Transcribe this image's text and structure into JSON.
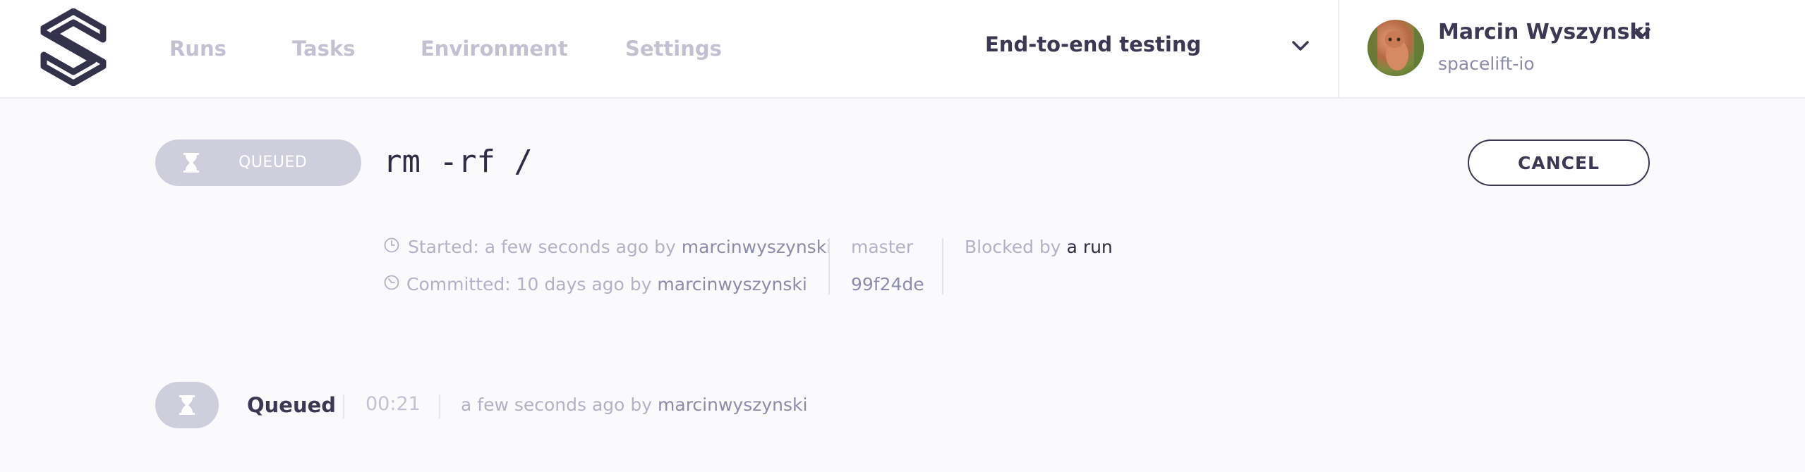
{
  "nav": {
    "items": [
      "Runs",
      "Tasks",
      "Environment",
      "Settings"
    ]
  },
  "stack": {
    "name": "End-to-end testing"
  },
  "user": {
    "name": "Marcin Wyszynski",
    "org": "spacelift-io"
  },
  "run": {
    "status": "QUEUED",
    "title": "rm -rf /",
    "cancel_label": "CANCEL",
    "started_prefix": "Started: a few seconds ago by",
    "started_by": "marcinwyszynski",
    "committed_prefix": "Committed: 10 days ago by",
    "committed_by": "marcinwyszynski",
    "branch": "master",
    "commit": "99f24de",
    "blocked_prefix": "Blocked by",
    "blocked_link": "a run"
  },
  "history": {
    "state": "Queued",
    "duration": "00:21",
    "time_prefix": "a few seconds ago by",
    "user": "marcinwyszynski"
  },
  "icons": {
    "logo": "spacelift-logo",
    "clock": "clock-icon",
    "commit": "commit-clock-icon",
    "hourglass": "hourglass-icon",
    "chevron": "chevron-down-icon"
  },
  "colors": {
    "muted": "#c2c1d2",
    "pill": "#cfcedd",
    "text": "#2f2d45"
  }
}
